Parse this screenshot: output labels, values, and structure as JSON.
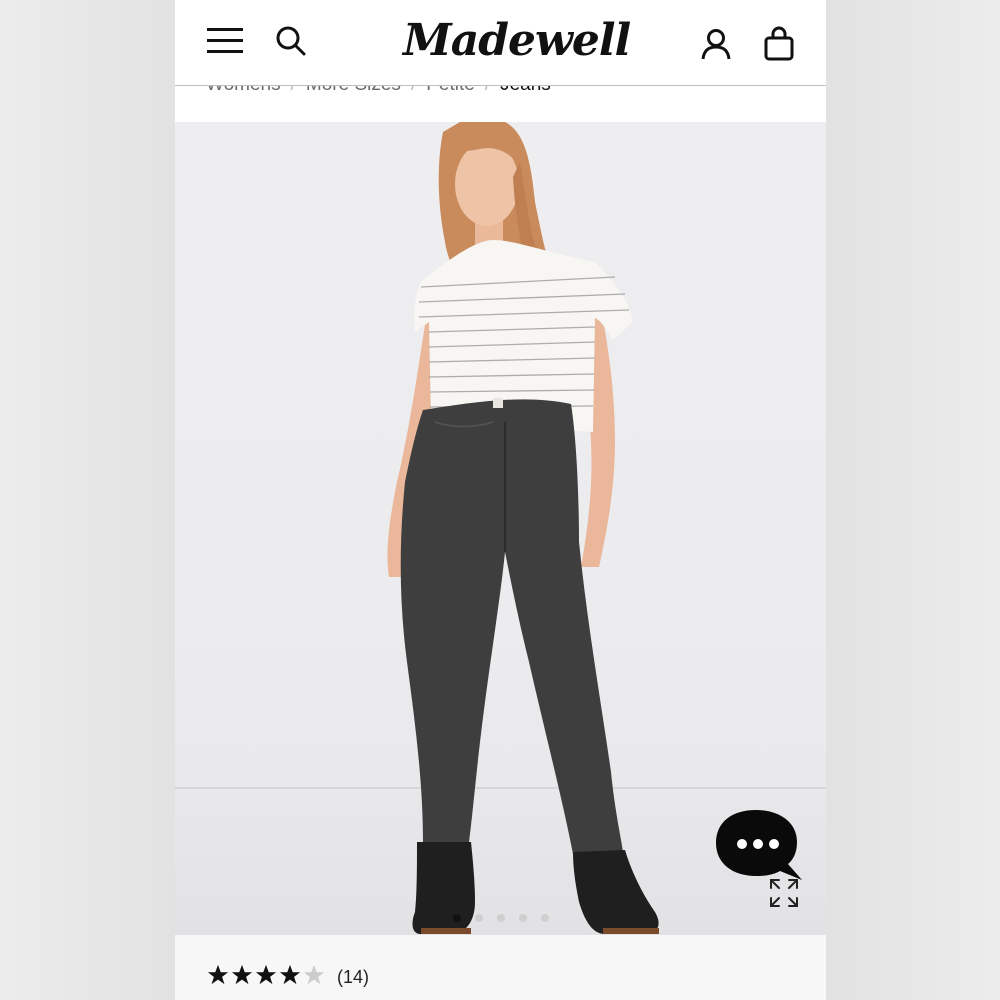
{
  "header": {
    "logo_text": "Madewell",
    "icons": [
      "menu-icon",
      "search-icon",
      "account-icon",
      "shopping-bag-icon"
    ]
  },
  "breadcrumb": {
    "items": [
      "Womens",
      "More Sizes",
      "Petite",
      "Jeans"
    ]
  },
  "gallery": {
    "image_count": 5,
    "active_index": 0,
    "image_description_icon": "expand-icon"
  },
  "chat": {
    "icon": "chat-bubble-icon",
    "dots": "•••"
  },
  "rating": {
    "stars": 4,
    "max_stars": 5,
    "count_label": "(14)"
  },
  "colors": {
    "text": "#111111",
    "muted": "#6b6b6b",
    "star_filled": "#111111",
    "star_empty": "#cccccc"
  }
}
